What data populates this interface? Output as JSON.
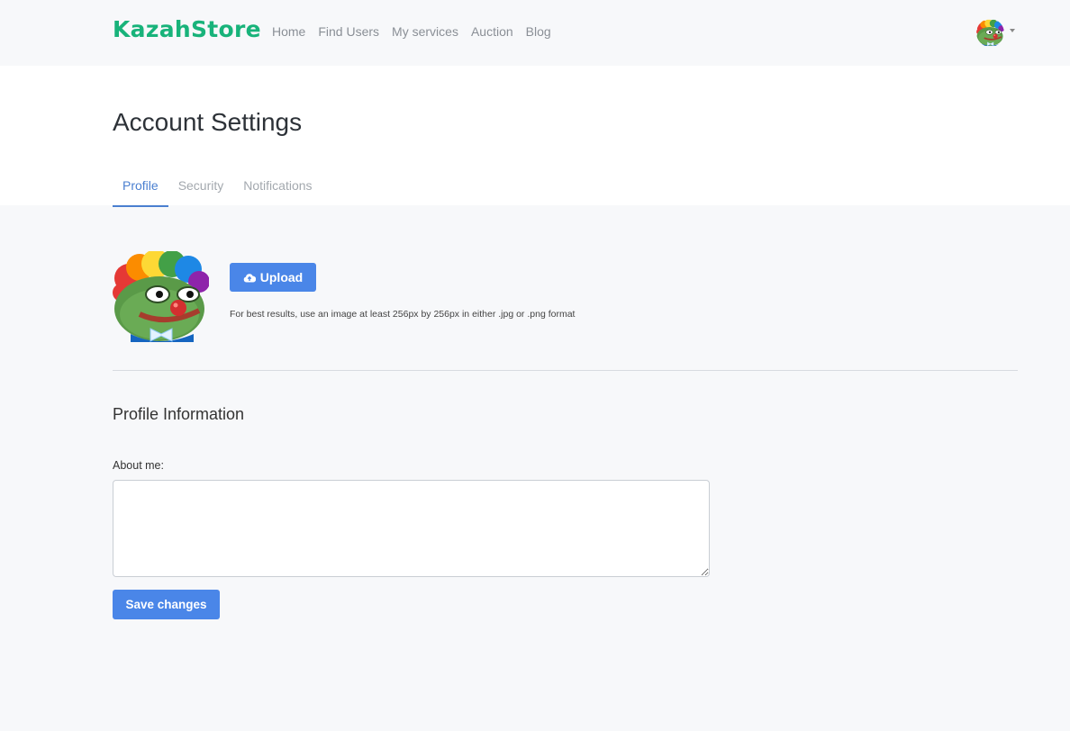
{
  "navbar": {
    "brand": "KazahStore",
    "links": [
      {
        "label": "Home"
      },
      {
        "label": "Find Users"
      },
      {
        "label": "My services"
      },
      {
        "label": "Auction"
      },
      {
        "label": "Blog"
      }
    ],
    "user_avatar_icon": "clown-frog-avatar-icon"
  },
  "page": {
    "title": "Account Settings",
    "tabs": [
      {
        "label": "Profile",
        "active": true
      },
      {
        "label": "Security",
        "active": false
      },
      {
        "label": "Notifications",
        "active": false
      }
    ]
  },
  "avatar": {
    "upload_label": "Upload",
    "upload_icon": "cloud-upload-icon",
    "hint": "For best results, use an image at least 256px by 256px in either .jpg or .png format"
  },
  "profile_info": {
    "section_title": "Profile Information",
    "about_label": "About me:",
    "about_value": "",
    "save_label": "Save changes"
  },
  "colors": {
    "brand": "#18b37a",
    "accent": "#4a86e8",
    "tab_active": "#4a7fd0"
  }
}
